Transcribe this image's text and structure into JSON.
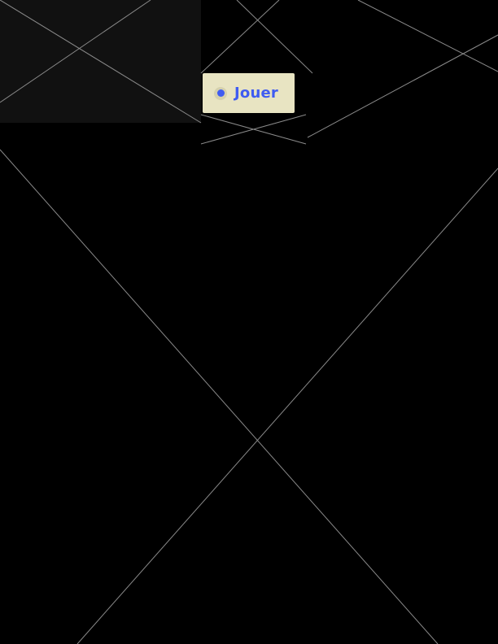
{
  "play_button": {
    "label": "Jouer",
    "icon": "radio-selected-icon"
  },
  "colors": {
    "background": "#000000",
    "panel": "#111111",
    "button_bg": "#e8e4c2",
    "accent": "#3f5cf1",
    "line": "#8a8a8a"
  }
}
